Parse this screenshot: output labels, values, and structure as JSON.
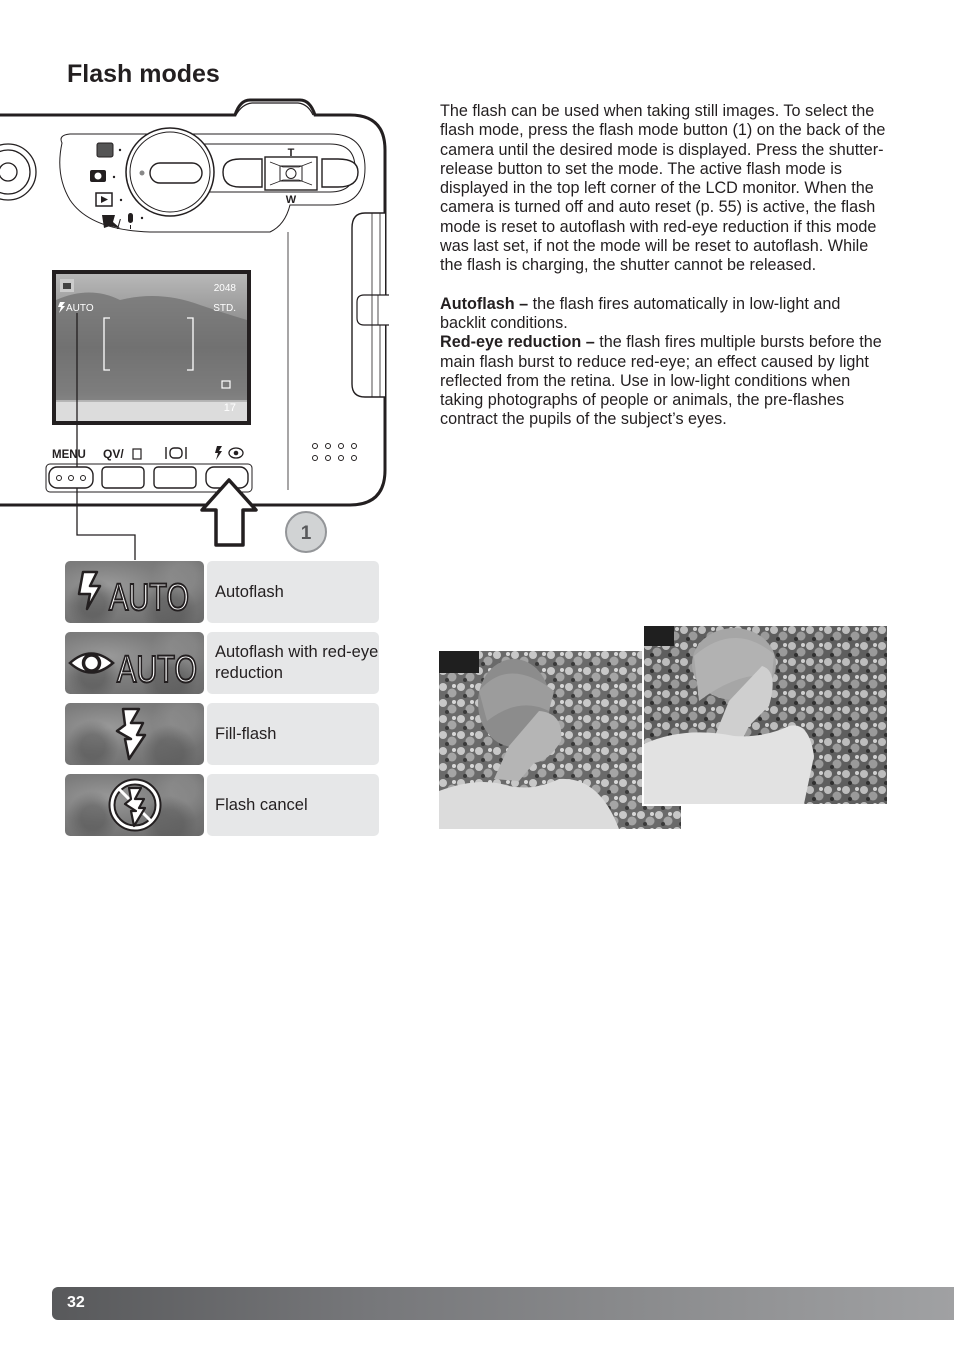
{
  "page": {
    "title": "Flash modes",
    "page_number": "32"
  },
  "body": {
    "intro": "The flash can be used when taking still images. To select the flash mode, press the flash mode button (1) on the back of the camera until the desired mode is displayed. Press the shutter-release button to set the mode. The active flash mode is displayed in the top left corner of the LCD monitor. When the camera is turned off and auto reset (p. 55) is active, the flash mode is reset to autoflash with red-eye reduction if this mode was last set, if not the mode will be reset to autoflash. While the flash is charging, the shutter cannot be released.",
    "definitions": [
      {
        "term": "Autoflash –",
        "text": " the flash fires automatically in low-light and backlit conditions."
      },
      {
        "term": "Red-eye reduction –",
        "text": " the flash fires multiple bursts before the main flash burst to reduce red-eye; an effect caused by light reflected from the retina. Use in low-light conditions when taking photographs of people or animals, the pre-flashes contract the pupils of the subject’s eyes."
      }
    ]
  },
  "camera": {
    "zoom_top": "T",
    "zoom_bottom": "W",
    "lcd": {
      "flash_indicator": "AUTO",
      "resolution": "2048",
      "quality": "STD.",
      "frames": "17"
    },
    "buttons": {
      "menu": "MENU",
      "qv": "QV/",
      "callout": "1"
    }
  },
  "flash_modes": [
    {
      "icon": "flash-auto-icon",
      "icon_text": "AUTO",
      "label": "Autoflash"
    },
    {
      "icon": "red-eye-auto-icon",
      "icon_text": "AUTO",
      "label": "Autoflash with red-eye reduction"
    },
    {
      "icon": "fill-flash-icon",
      "icon_text": "",
      "label": "Fill-flash"
    },
    {
      "icon": "flash-cancel-icon",
      "icon_text": "",
      "label": "Flash cancel"
    }
  ],
  "colors": {
    "text": "#231f20",
    "label_bg": "#e6e7e8",
    "footer_start": "#58595b",
    "footer_end": "#a0a1a3",
    "callout_bg": "#d1d3d4"
  }
}
